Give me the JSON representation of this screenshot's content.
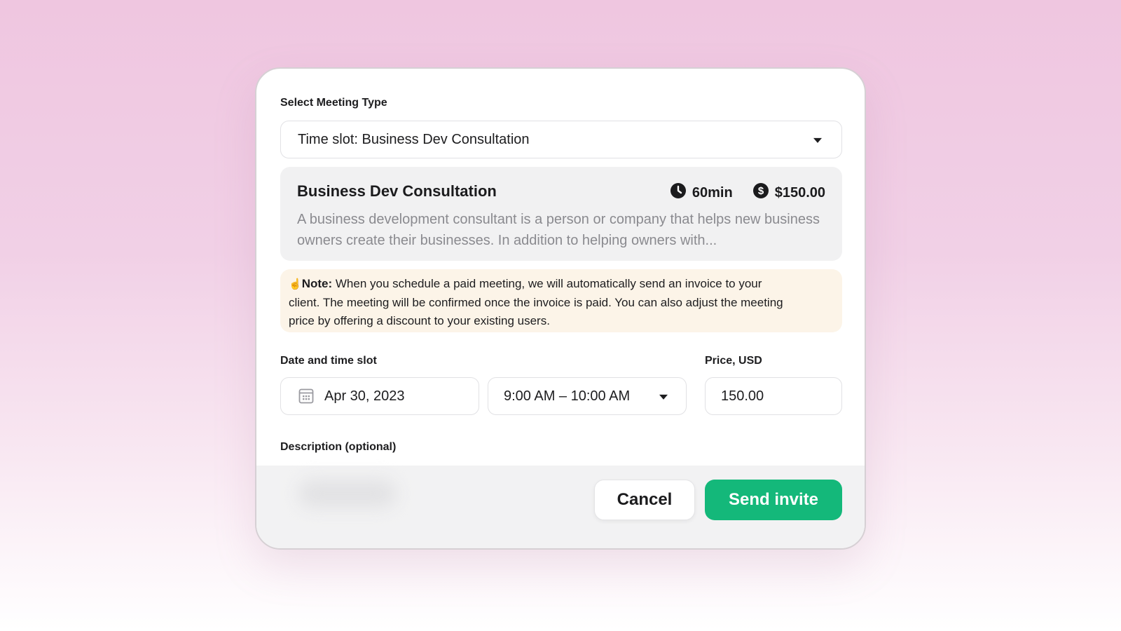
{
  "meeting_type": {
    "label": "Select Meeting Type",
    "selected": "Time slot: Business Dev Consultation"
  },
  "details": {
    "title": "Business Dev Consultation",
    "duration": "60min",
    "price": "$150.00",
    "description": "A business development consultant is a person or company that helps new business owners create their businesses. In addition to helping owners with..."
  },
  "note": {
    "emoji": "☝️",
    "label": "Note:",
    "text_1": " When you schedule a paid meeting, we will automatically send an invoice to your",
    "text_2": "client. The meeting will be confirmed once the invoice is paid. You can also adjust the meeting",
    "text_3": "price by offering a discount to your existing users."
  },
  "schedule": {
    "label": "Date and time slot",
    "date": "Apr 30, 2023",
    "time_slot": "9:00 AM – 10:00 AM"
  },
  "price_field": {
    "label": "Price, USD",
    "value": "150.00"
  },
  "description_field": {
    "label": "Description (optional)"
  },
  "buttons": {
    "cancel": "Cancel",
    "send": "Send invite"
  },
  "colors": {
    "accent": "#14b87a",
    "note_bg": "#fcf4e8",
    "card_bg": "#f1f1f2"
  },
  "icons": {
    "clock": "clock-icon",
    "dollar": "dollar-circle-icon",
    "calendar": "calendar-icon",
    "dropdown": "chevron-down-icon"
  }
}
